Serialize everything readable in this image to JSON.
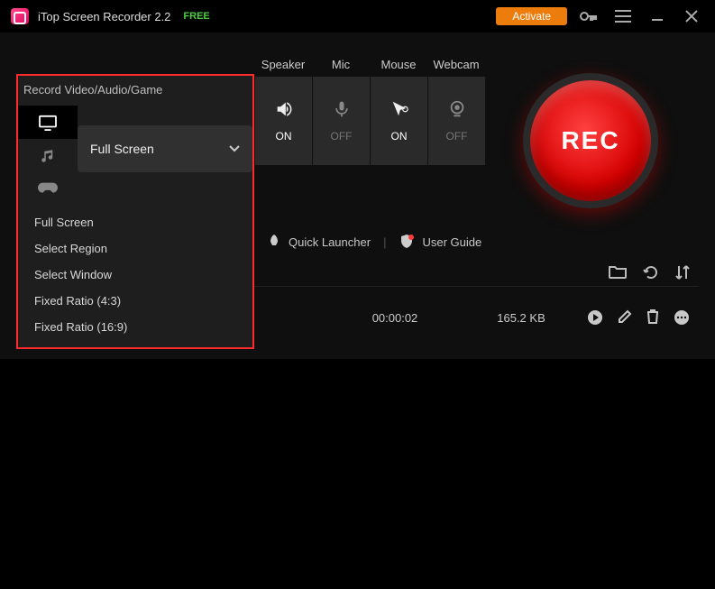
{
  "titlebar": {
    "app_name": "iTop Screen Recorder 2.2",
    "free_tag": "FREE",
    "activate": "Activate"
  },
  "headers": {
    "record": "Record Video/Audio/Game",
    "speaker": "Speaker",
    "mic": "Mic",
    "mouse": "Mouse",
    "webcam": "Webcam"
  },
  "states": {
    "speaker": "ON",
    "mic": "OFF",
    "mouse": "ON",
    "webcam": "OFF"
  },
  "dropdown": {
    "selected": "Full Screen",
    "options": [
      "Full Screen",
      "Select Region",
      "Select Window",
      "Fixed Ratio  (4:3)",
      "Fixed Ratio  (16:9)"
    ]
  },
  "rec_label": "REC",
  "links": {
    "quick_launcher": "Quick Launcher",
    "user_guide": "User Guide"
  },
  "video": {
    "duration": "00:00:02",
    "size": "165.2 KB"
  }
}
